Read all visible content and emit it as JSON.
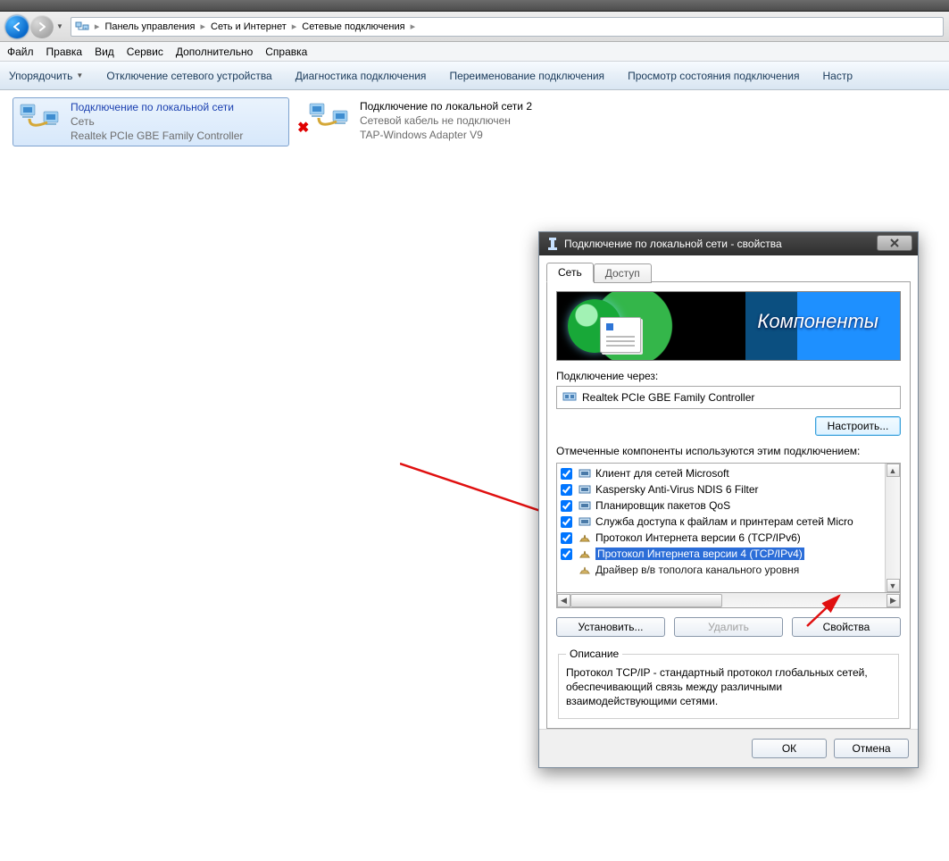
{
  "breadcrumb": {
    "seg1": "Панель управления",
    "seg2": "Сеть и Интернет",
    "seg3": "Сетевые подключения"
  },
  "menubar": {
    "file": "Файл",
    "edit": "Правка",
    "view": "Вид",
    "service": "Сервис",
    "advanced": "Дополнительно",
    "help": "Справка"
  },
  "toolbar": {
    "organize": "Упорядочить",
    "disable": "Отключение сетевого устройства",
    "diagnose": "Диагностика подключения",
    "rename": "Переименование подключения",
    "status": "Просмотр состояния подключения",
    "settings": "Настр"
  },
  "connections": {
    "c1": {
      "title": "Подключение по локальной сети",
      "line2": "Сеть",
      "line3": "Realtek PCIe GBE Family Controller"
    },
    "c2": {
      "title": "Подключение по локальной сети 2",
      "line2": "Сетевой кабель не подключен",
      "line3": "TAP-Windows Adapter V9"
    }
  },
  "dialog": {
    "title": "Подключение по локальной сети - свойства",
    "tab_network": "Сеть",
    "tab_access": "Доступ",
    "banner_text": "Компоненты",
    "connect_via_label": "Подключение через:",
    "adapter": "Realtek PCIe GBE Family Controller",
    "configure_btn": "Настроить...",
    "components_label": "Отмеченные компоненты используются этим подключением:",
    "items": {
      "i0": "Клиент для сетей Microsoft",
      "i1": "Kaspersky Anti-Virus NDIS 6 Filter",
      "i2": "Планировщик пакетов QoS",
      "i3": "Служба доступа к файлам и принтерам сетей Micro",
      "i4": "Протокол Интернета версии 6 (TCP/IPv6)",
      "i5": "Протокол Интернета версии 4 (TCP/IPv4)",
      "i6": "Драйвер в/в тополога канального уровня"
    },
    "install_btn": "Установить...",
    "remove_btn": "Удалить",
    "props_btn": "Свойства",
    "desc_legend": "Описание",
    "desc_text": "Протокол TCP/IP - стандартный протокол глобальных сетей, обеспечивающий связь между различными взаимодействующими сетями.",
    "ok": "ОК",
    "cancel": "Отмена"
  }
}
